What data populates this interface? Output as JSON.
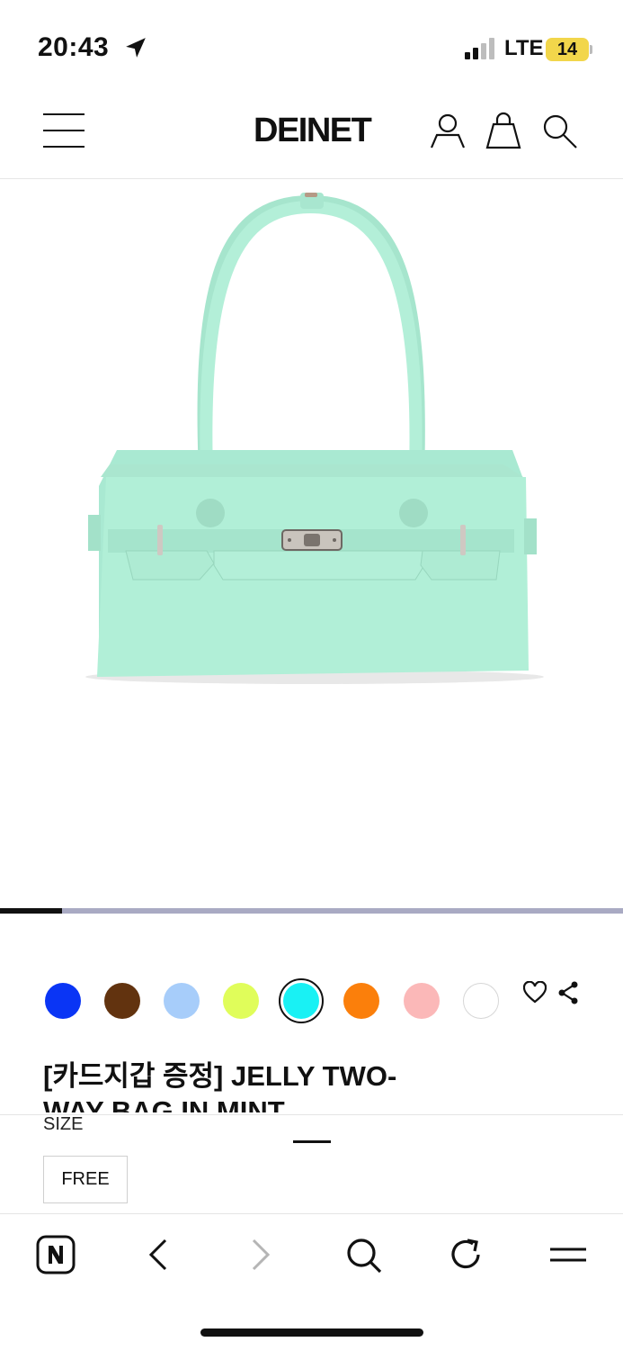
{
  "status_bar": {
    "time": "20:43",
    "network": "LTE",
    "battery": "14"
  },
  "header": {
    "brand": "DEINET",
    "icons": [
      "menu-icon",
      "user-icon",
      "shopping-bag-icon",
      "search-icon"
    ]
  },
  "product": {
    "image_alt": "Mint jelly two-way bag",
    "carousel_progress": 0.1,
    "title": "[카드지갑 증정] JELLY TWO-WAY BAG IN MINT",
    "selected_color_index": 4,
    "colors": [
      {
        "name": "blue",
        "hex": "#0a35f5"
      },
      {
        "name": "brown",
        "hex": "#62330f"
      },
      {
        "name": "light-blue",
        "hex": "#a7cdfa"
      },
      {
        "name": "lime",
        "hex": "#e0fd5a"
      },
      {
        "name": "cyan",
        "hex": "#19f1f4"
      },
      {
        "name": "orange",
        "hex": "#fb7f0b"
      },
      {
        "name": "pink",
        "hex": "#fbb8b8"
      },
      {
        "name": "white",
        "hex": "#ffffff"
      }
    ]
  },
  "options": {
    "size_label": "SIZE",
    "size_value": "FREE"
  },
  "browser": {
    "buttons": [
      "naver-home-icon",
      "back-icon",
      "forward-icon",
      "search-icon",
      "reload-icon",
      "menu-icon"
    ]
  }
}
